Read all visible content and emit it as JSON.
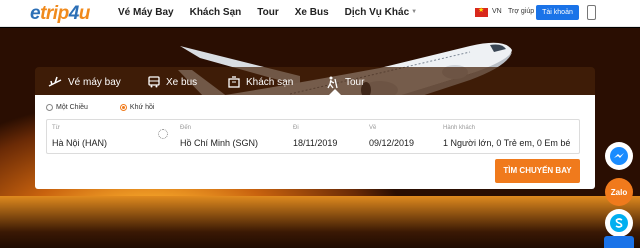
{
  "logo": {
    "e": "e",
    "trip": "trip",
    "four": "4",
    "u": "u"
  },
  "nav": {
    "items": [
      "Vé Máy Bay",
      "Khách Sạn",
      "Tour",
      "Xe Bus",
      "Dịch Vụ Khác"
    ]
  },
  "header": {
    "lang": "VN",
    "help": "Trợ giúp",
    "account": "Tài khoản"
  },
  "search": {
    "tabs": [
      "Vé máy bay",
      "Xe bus",
      "Khách sạn",
      "Tour"
    ],
    "trip_type": {
      "one_way": "Một Chiều",
      "round_trip": "Khứ hồi",
      "selected": "Khứ hồi"
    },
    "fields": {
      "from": {
        "label": "Từ",
        "value": "Hà Nội (HAN)"
      },
      "to": {
        "label": "Đến",
        "value": "Hồ Chí Minh (SGN)"
      },
      "depart": {
        "label": "Đi",
        "value": "18/11/2019"
      },
      "return": {
        "label": "Về",
        "value": "09/12/2019"
      },
      "passengers": {
        "label": "Hành khách",
        "value": "1 Người lớn, 0 Trẻ em, 0 Em bé"
      }
    },
    "button": "TÌM CHUYẾN BAY"
  },
  "social": {
    "zalo": "Zalo"
  },
  "colors": {
    "accent": "#f07a1c",
    "primary": "#1a73e8"
  },
  "icons": [
    "plane-icon",
    "bus-icon",
    "hotel-icon",
    "tour-icon",
    "swap-icon",
    "messenger-icon",
    "zalo-icon",
    "skype-icon",
    "phone-icon"
  ]
}
